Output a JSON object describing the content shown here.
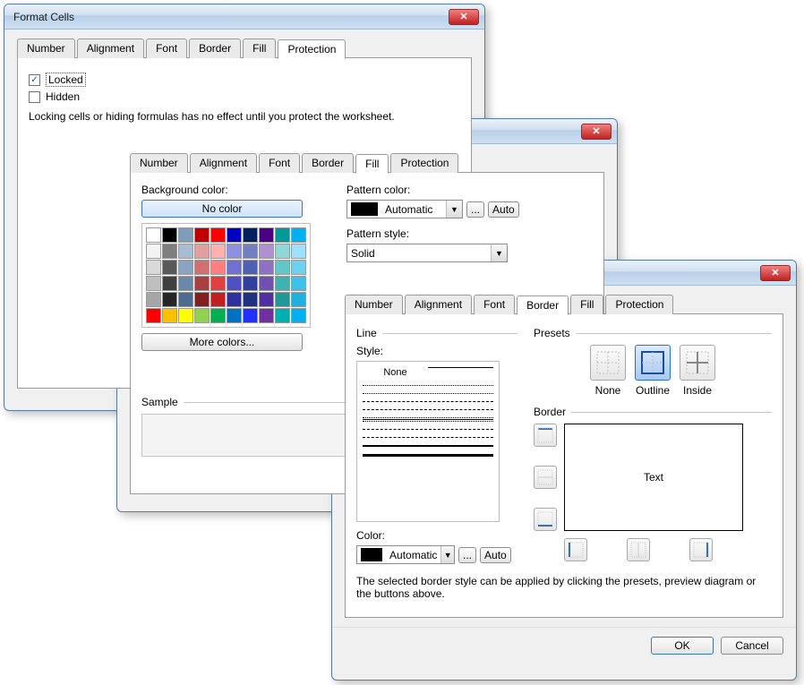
{
  "window_title": "Format Cells",
  "tabs": {
    "number": "Number",
    "alignment": "Alignment",
    "font": "Font",
    "border": "Border",
    "fill": "Fill",
    "protection": "Protection"
  },
  "protection": {
    "locked": "Locked",
    "hidden": "Hidden",
    "note": "Locking cells or hiding formulas has no effect until you protect the worksheet."
  },
  "fill": {
    "bg_label": "Background color:",
    "no_color": "No color",
    "more_colors": "More colors...",
    "pattern_color_label": "Pattern color:",
    "automatic": "Automatic",
    "auto_btn": "Auto",
    "ellipsis": "...",
    "pattern_style_label": "Pattern style:",
    "pattern_style_value": "Solid",
    "sample": "Sample",
    "palette": [
      "#ffffff",
      "#000000",
      "#7f9db9",
      "#c00000",
      "#ff0000",
      "#0000c0",
      "#002060",
      "#4b0082",
      "#009999",
      "#00b0f0",
      "#f2f2f2",
      "#7f7f7f",
      "#a8bcd2",
      "#e0a0a0",
      "#ffb0b0",
      "#9090e0",
      "#7080c0",
      "#b090d0",
      "#90d8d8",
      "#a0e0ff",
      "#d9d9d9",
      "#595959",
      "#8aa4c0",
      "#d07070",
      "#ff8080",
      "#7070d0",
      "#5060b0",
      "#9070c0",
      "#60c8c8",
      "#70d0f0",
      "#bfbfbf",
      "#404040",
      "#6c88a8",
      "#a84040",
      "#e04040",
      "#5050c0",
      "#3040a0",
      "#7050b0",
      "#40b0b0",
      "#40c0e8",
      "#a6a6a6",
      "#262626",
      "#4e6c90",
      "#802020",
      "#c02020",
      "#3030a0",
      "#203080",
      "#5030a0",
      "#209898",
      "#20b0e0",
      "#ff0000",
      "#ffc000",
      "#ffff00",
      "#92d050",
      "#00b050",
      "#0070c0",
      "#2030ff",
      "#7030a0",
      "#00b0b0",
      "#00b0f0"
    ]
  },
  "border": {
    "line_legend": "Line",
    "style_label": "Style:",
    "none_style": "None",
    "color_label": "Color:",
    "automatic": "Automatic",
    "auto_btn": "Auto",
    "ellipsis": "...",
    "presets_legend": "Presets",
    "preset_none": "None",
    "preset_outline": "Outline",
    "preset_inside": "Inside",
    "border_legend": "Border",
    "preview_text": "Text",
    "hint": "The selected border style can be applied by clicking the presets, preview diagram or the buttons above."
  },
  "buttons": {
    "ok": "OK",
    "cancel": "Cancel"
  }
}
